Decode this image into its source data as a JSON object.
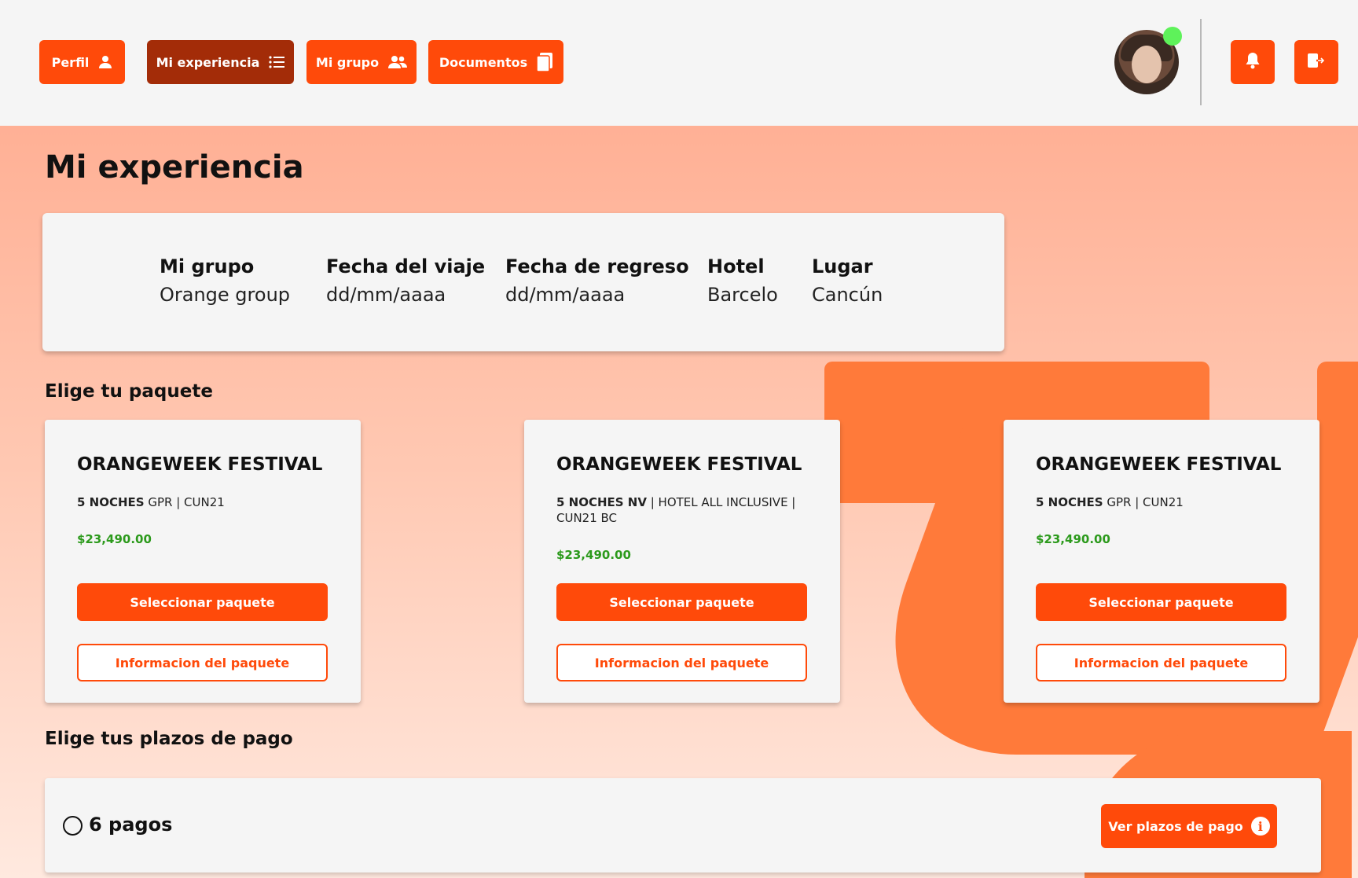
{
  "nav": {
    "items": [
      {
        "label": "Perfil",
        "icon": "user-icon",
        "active": false
      },
      {
        "label": "Mi experiencia",
        "icon": "list-icon",
        "active": true
      },
      {
        "label": "Mi grupo",
        "icon": "users-icon",
        "active": false
      },
      {
        "label": "Documentos",
        "icon": "document-icon",
        "active": false
      }
    ]
  },
  "header": {
    "avatar": "user-avatar",
    "online_status": "online",
    "notifications_icon": "bell-icon",
    "logout_icon": "logout-icon"
  },
  "page": {
    "title": "Mi experiencia"
  },
  "trip": {
    "group_label": "Mi grupo",
    "group_value": "Orange group",
    "departure_label": "Fecha del viaje",
    "departure_value": "dd/mm/aaaa",
    "return_label": "Fecha de regreso",
    "return_value": "dd/mm/aaaa",
    "hotel_label": "Hotel",
    "hotel_value": "Barcelo",
    "place_label": "Lugar",
    "place_value": "Cancún"
  },
  "packages": {
    "section_title": "Elige tu paquete",
    "items": [
      {
        "name": "ORANGEWEEK FESTIVAL",
        "nights": "5 NOCHES",
        "details": " GPR | CUN21",
        "price": "$23,490.00",
        "select_label": "Seleccionar paquete",
        "info_label": "Informacion del paquete"
      },
      {
        "name": "ORANGEWEEK FESTIVAL",
        "nights": "5 NOCHES NV",
        "details": " | HOTEL ALL INCLUSIVE | CUN21 BC",
        "price": "$23,490.00",
        "select_label": "Seleccionar paquete",
        "info_label": "Informacion del paquete"
      },
      {
        "name": "ORANGEWEEK FESTIVAL",
        "nights": "5 NOCHES",
        "details": " GPR | CUN21",
        "price": "$23,490.00",
        "select_label": "Seleccionar paquete",
        "info_label": "Informacion del paquete"
      }
    ]
  },
  "payments": {
    "section_title": "Elige tus plazos de pago",
    "option_label": "6 pagos",
    "selected": false,
    "button_label": "Ver plazos de pago",
    "button_icon": "info-icon"
  },
  "colors": {
    "accent": "#ff4a0a",
    "active_nav": "#a32c08",
    "price": "#2c9a1c",
    "online": "#5ef25a"
  }
}
